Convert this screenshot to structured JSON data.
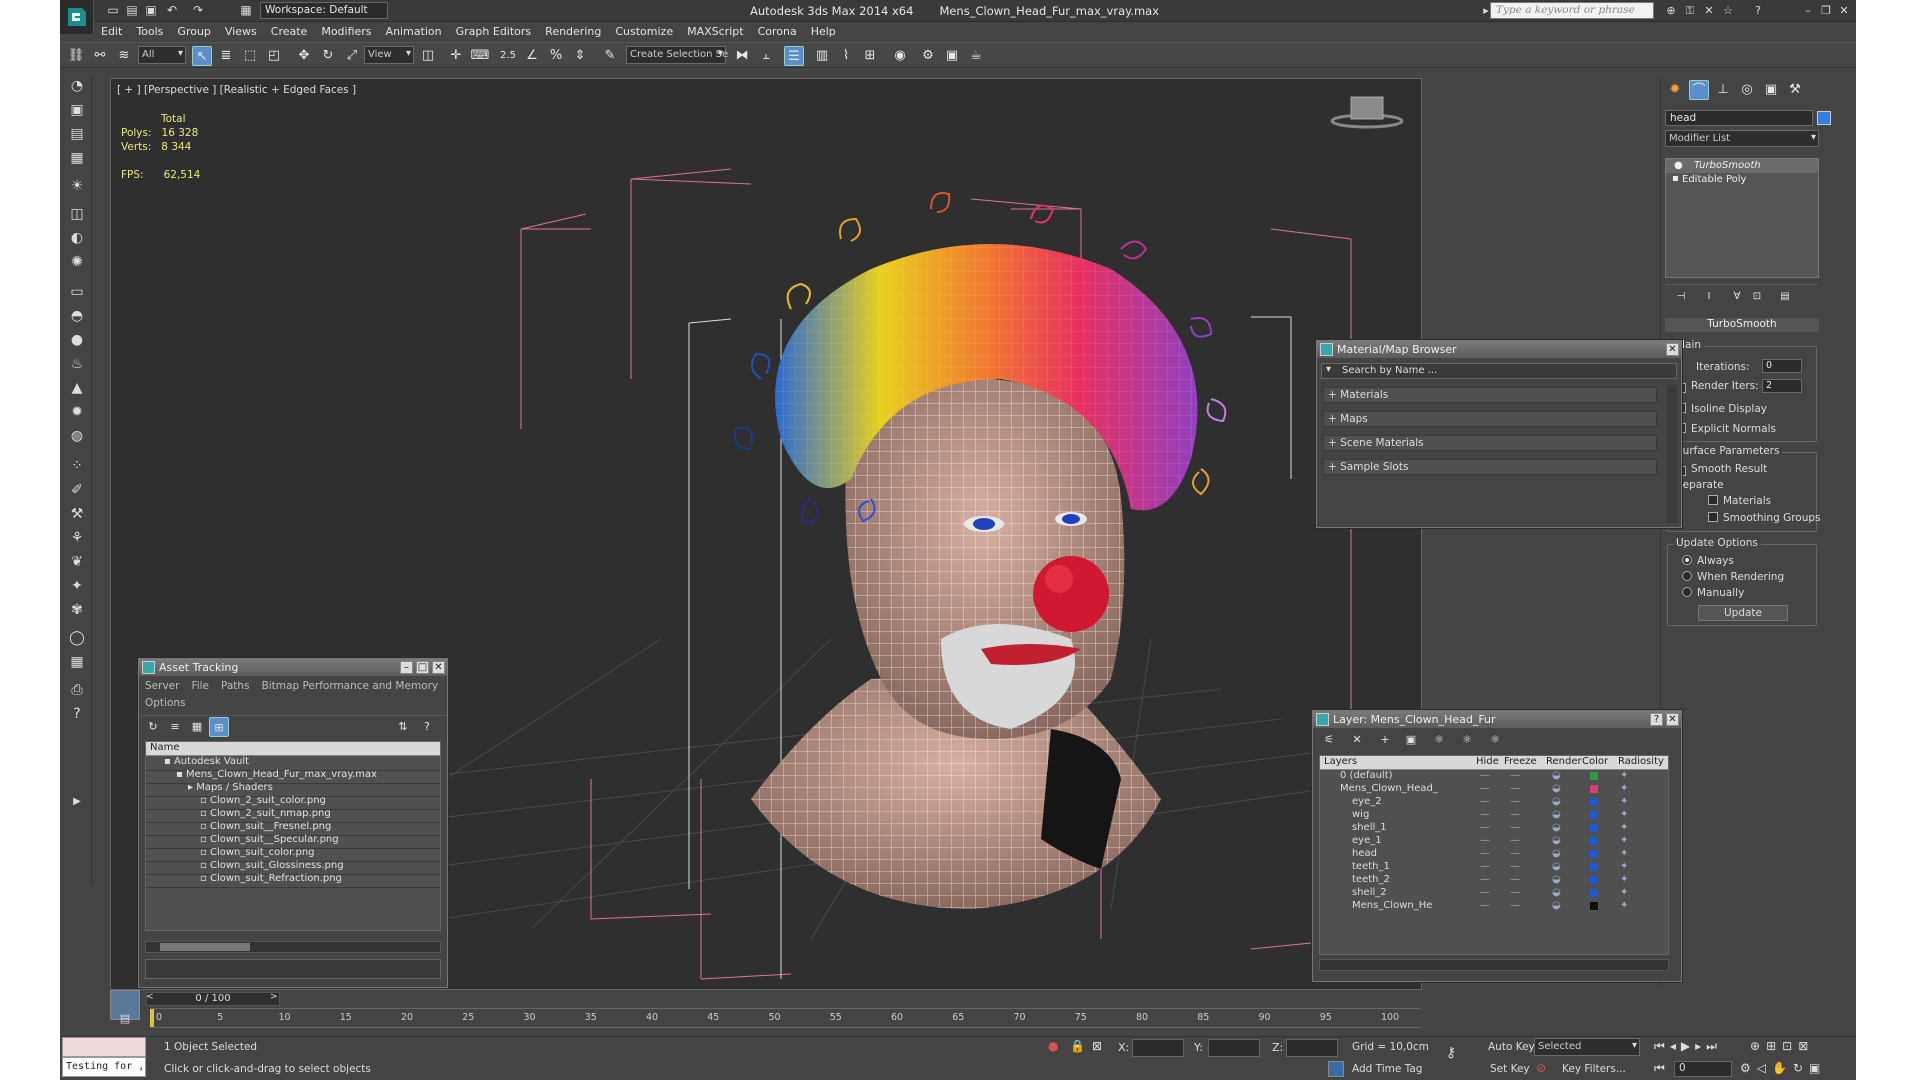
{
  "titlebar": {
    "workspace": "Workspace: Default",
    "app_name": "Autodesk 3ds Max  2014 x64",
    "file_name": "Mens_Clown_Head_Fur_max_vray.max",
    "search_placeholder": "Type a keyword or phrase"
  },
  "menu": [
    "Edit",
    "Tools",
    "Group",
    "Views",
    "Create",
    "Modifiers",
    "Animation",
    "Graph Editors",
    "Rendering",
    "Customize",
    "MAXScript",
    "Corona",
    "Help"
  ],
  "toolbar": {
    "selection_filter": "All",
    "ref_coord": "View",
    "snap_label": "2.5",
    "named_selection": "Create Selection Se"
  },
  "viewport": {
    "label": "[ + ] [Perspective ] [Realistic + Edged Faces ]",
    "stats_total": "Total",
    "polys_label": "Polys:",
    "polys": "16 328",
    "verts_label": "Verts:",
    "verts": "8 344",
    "fps_label": "FPS:",
    "fps": "62,514"
  },
  "command_panel": {
    "object_name": "head",
    "modifier_list": "Modifier List",
    "stack": [
      "TurboSmooth",
      "Editable Poly"
    ],
    "rollout_title": "TurboSmooth",
    "main_group": "Main",
    "iterations_label": "Iterations:",
    "iterations": "0",
    "render_iters_label": "Render Iters:",
    "render_iters": "2",
    "isoline": "Isoline Display",
    "explicit_normals": "Explicit Normals",
    "surface_params": "Surface Parameters",
    "smooth_result": "Smooth Result",
    "separate": "Separate",
    "materials": "Materials",
    "smoothing_groups": "Smoothing Groups",
    "update_options": "Update Options",
    "always": "Always",
    "when_rendering": "When Rendering",
    "manually": "Manually",
    "update_button": "Update"
  },
  "material_browser": {
    "title": "Material/Map Browser",
    "search": "Search by Name ...",
    "sections": [
      "+ Materials",
      "+ Maps",
      "+ Scene Materials",
      "+ Sample Slots"
    ]
  },
  "asset_tracking": {
    "title": "Asset Tracking",
    "menu": [
      "Server",
      "File",
      "Paths",
      "Bitmap Performance and Memory"
    ],
    "options": "Options",
    "column": "Name",
    "rows": [
      {
        "indent": 1,
        "text": "Autodesk Vault"
      },
      {
        "indent": 2,
        "text": "Mens_Clown_Head_Fur_max_vray.max"
      },
      {
        "indent": 3,
        "text": "Maps / Shaders"
      },
      {
        "indent": 4,
        "text": "Clown_2_suit_color.png"
      },
      {
        "indent": 4,
        "text": "Clown_2_suit_nmap.png"
      },
      {
        "indent": 4,
        "text": "Clown_suit__Fresnel.png"
      },
      {
        "indent": 4,
        "text": "Clown_suit__Specular.png"
      },
      {
        "indent": 4,
        "text": "Clown_suit_color.png"
      },
      {
        "indent": 4,
        "text": "Clown_suit_Glossiness.png"
      },
      {
        "indent": 4,
        "text": "Clown_suit_Refraction.png"
      }
    ]
  },
  "layers": {
    "title": "Layer: Mens_Clown_Head_Fur",
    "columns": [
      "Layers",
      "Hide",
      "Freeze",
      "Render",
      "Color",
      "Radiosity"
    ],
    "rows": [
      {
        "name": "0 (default)",
        "indent": 1,
        "color": "#2a9a3a"
      },
      {
        "name": "Mens_Clown_Head_",
        "indent": 1,
        "color": "#d8407a"
      },
      {
        "name": "eye_2",
        "indent": 2,
        "color": "#1a5ad8"
      },
      {
        "name": "wig",
        "indent": 2,
        "color": "#1a5ad8"
      },
      {
        "name": "shell_1",
        "indent": 2,
        "color": "#1a5ad8"
      },
      {
        "name": "eye_1",
        "indent": 2,
        "color": "#1a5ad8"
      },
      {
        "name": "head",
        "indent": 2,
        "color": "#1a5ad8"
      },
      {
        "name": "teeth_1",
        "indent": 2,
        "color": "#1a5ad8"
      },
      {
        "name": "teeth_2",
        "indent": 2,
        "color": "#1a5ad8"
      },
      {
        "name": "shell_2",
        "indent": 2,
        "color": "#1a5ad8"
      },
      {
        "name": "Mens_Clown_He",
        "indent": 2,
        "color": "#111111"
      }
    ]
  },
  "timeline": {
    "frame": "0 / 100",
    "ticks": [
      "0",
      "5",
      "10",
      "15",
      "20",
      "25",
      "30",
      "35",
      "40",
      "45",
      "50",
      "55",
      "60",
      "65",
      "70",
      "75",
      "80",
      "85",
      "90",
      "95",
      "100"
    ]
  },
  "status": {
    "script_box": "Testing for ,",
    "selection": "1 Object Selected",
    "prompt": "Click or click-and-drag to select objects",
    "x_label": "X:",
    "y_label": "Y:",
    "z_label": "Z:",
    "grid": "Grid = 10,0cm",
    "add_time_tag": "Add Time Tag",
    "auto_key": "Auto Key",
    "set_key": "Set Key",
    "selected": "Selected",
    "key_filters": "Key Filters...",
    "frame_field": "0"
  }
}
